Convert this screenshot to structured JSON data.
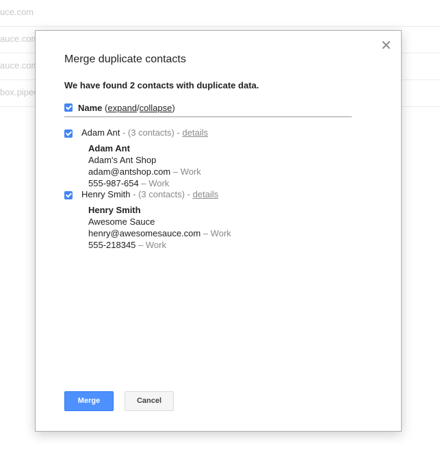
{
  "background": {
    "rows": [
      "uce.com",
      "auce.com",
      "auce.com",
      "box.piped"
    ]
  },
  "dialog": {
    "title": "Merge duplicate contacts",
    "close_glyph": "✕",
    "subtitle": "We have found 2 contacts with duplicate data.",
    "name_header": {
      "checked": true,
      "label": "Name",
      "open_paren": "(",
      "expand": "expand",
      "slash": "/",
      "collapse": "collapse",
      "close_paren": ")"
    },
    "groups": [
      {
        "checked": true,
        "name": "Adam Ant",
        "count_text": " - (3 contacts) - ",
        "details": "details",
        "card": {
          "name": "Adam Ant",
          "company": "Adam's Ant Shop",
          "email": "adam@antshop.com",
          "email_type": " – Work",
          "phone": "555-987-654",
          "phone_type": " – Work"
        }
      },
      {
        "checked": true,
        "name": "Henry Smith",
        "count_text": " - (3 contacts) - ",
        "details": "details",
        "card": {
          "name": "Henry Smith",
          "company": "Awesome Sauce",
          "email": "henry@awesomesauce.com",
          "email_type": " – Work",
          "phone": "555-218345",
          "phone_type": " – Work"
        }
      }
    ],
    "buttons": {
      "merge": "Merge",
      "cancel": "Cancel"
    },
    "colors": {
      "primary": "#4d90fe",
      "checkbox": "#4285f4"
    }
  }
}
